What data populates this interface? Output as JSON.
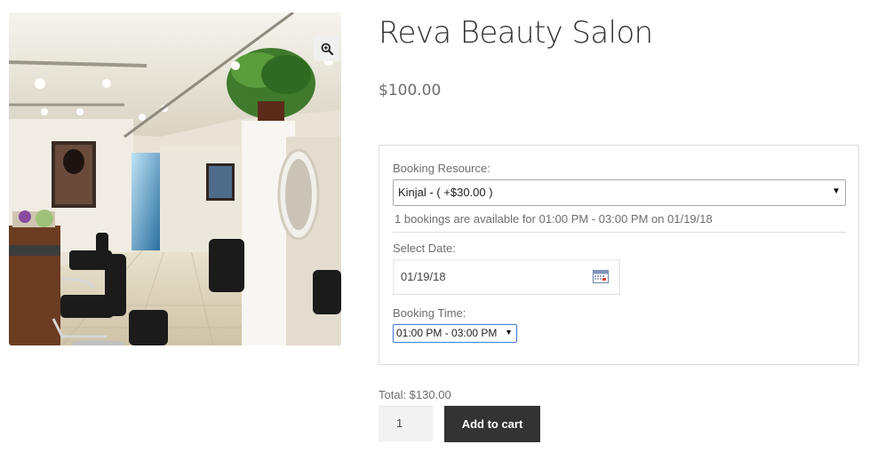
{
  "product": {
    "title": "Reva Beauty Salon",
    "price": "$100.00",
    "image_alt": "salon interior photo"
  },
  "booking": {
    "resource_label": "Booking Resource:",
    "resource_value": "Kinjal - ( +$30.00 )",
    "availability": "1 bookings are available for 01:00 PM - 03:00 PM on 01/19/18",
    "date_label": "Select Date:",
    "date_value": "01/19/18",
    "time_label": "Booking Time:",
    "time_value": "01:00 PM - 03:00 PM"
  },
  "cart": {
    "total": "Total: $130.00",
    "quantity": "1",
    "add_to_cart": "Add to cart"
  },
  "icons": {
    "zoom": "magnifier-plus-icon",
    "calendar": "calendar-icon",
    "dropdown": "caret-down-icon"
  }
}
